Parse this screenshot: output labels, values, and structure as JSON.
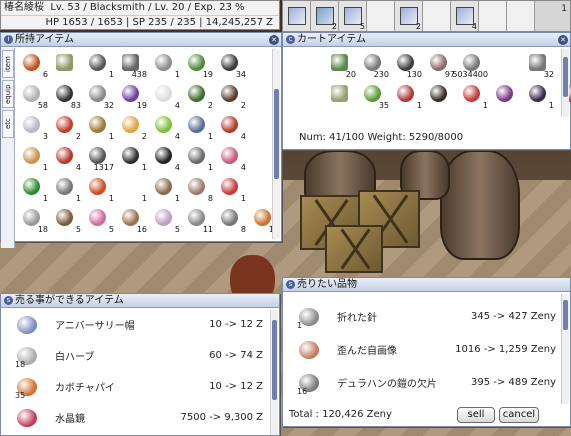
{
  "status": {
    "name": "椿名綾桜",
    "level_line": "Lv. 53 / Blacksmith / Lv. 20 / Exp. 23 %",
    "vitals_line": "HP  1653 / 1653  |  SP  235 / 235  |  14,245,257 Z"
  },
  "hotbar": {
    "slots": [
      "",
      "2",
      "5",
      "",
      "2",
      "",
      "4",
      "",
      ""
    ],
    "page": "1"
  },
  "inventory": {
    "title": "所持アイテム",
    "tabs": [
      "item",
      "equip",
      "etc"
    ],
    "items": [
      {
        "count": "6",
        "color": "#c0541e"
      },
      {
        "count": "",
        "color": "#8f9a6a",
        "box": true
      },
      {
        "count": "1",
        "color": "#555"
      },
      {
        "count": "438",
        "color": "#666",
        "box": true
      },
      {
        "count": "1",
        "color": "#8c8c8c"
      },
      {
        "count": "19",
        "color": "#4f8a3a"
      },
      {
        "count": "34",
        "color": "#3a3a3a"
      },
      {
        "count": "",
        "color": "#fff"
      },
      {
        "count": "58",
        "color": "#b2b2b2"
      },
      {
        "count": "83",
        "color": "#333"
      },
      {
        "count": "32",
        "color": "#888"
      },
      {
        "count": "19",
        "color": "#6b3fa0"
      },
      {
        "count": "4",
        "color": "#ddd"
      },
      {
        "count": "2",
        "color": "#3e6b2e"
      },
      {
        "count": "2",
        "color": "#5b3b2a"
      },
      {
        "count": "",
        "color": "#fff"
      },
      {
        "count": "3",
        "color": "#b8b8c8"
      },
      {
        "count": "2",
        "color": "#c23d2a"
      },
      {
        "count": "1",
        "color": "#9b7a33"
      },
      {
        "count": "2",
        "color": "#e0a442"
      },
      {
        "count": "4",
        "color": "#7cc23a"
      },
      {
        "count": "1",
        "color": "#5a6d99"
      },
      {
        "count": "4",
        "color": "#b33b2a"
      },
      {
        "count": "",
        "color": "#fff"
      },
      {
        "count": "1",
        "color": "#c9954a"
      },
      {
        "count": "4",
        "color": "#b33b2a"
      },
      {
        "count": "1317",
        "color": "#555"
      },
      {
        "count": "1",
        "color": "#2e2e2e"
      },
      {
        "count": "4",
        "color": "#222"
      },
      {
        "count": "1",
        "color": "#6a6a6a"
      },
      {
        "count": "4",
        "color": "#c95a80"
      },
      {
        "count": "",
        "color": "#fff"
      },
      {
        "count": "1",
        "color": "#2e8a2e"
      },
      {
        "count": "1",
        "color": "#777"
      },
      {
        "count": "1",
        "color": "#d04a22"
      },
      {
        "count": "1",
        "color": "#fff"
      },
      {
        "count": "1",
        "color": "#8a6a4a"
      },
      {
        "count": "8",
        "color": "#9b7a6a"
      },
      {
        "count": "1",
        "color": "#c83a3a"
      },
      {
        "count": "",
        "color": "#fff"
      },
      {
        "count": "18",
        "color": "#999"
      },
      {
        "count": "5",
        "color": "#7a5a3a"
      },
      {
        "count": "5",
        "color": "#d06a9a"
      },
      {
        "count": "16",
        "color": "#a07050"
      },
      {
        "count": "5",
        "color": "#c0a0c0"
      },
      {
        "count": "11",
        "color": "#888"
      },
      {
        "count": "8",
        "color": "#777"
      },
      {
        "count": "10",
        "color": "#d0702a"
      }
    ]
  },
  "cart": {
    "title": "カートアイテム",
    "items": [
      {
        "count": "20",
        "color": "#5b8a4a",
        "box": true
      },
      {
        "count": "230",
        "color": "#777"
      },
      {
        "count": "130",
        "color": "#3d3d3d"
      },
      {
        "count": "97",
        "color": "#8a6a6a"
      },
      {
        "count": "5034400",
        "color": "#777"
      },
      {
        "count": "",
        "color": "#fff"
      },
      {
        "count": "32",
        "color": "#777",
        "box": true
      },
      {
        "count": "",
        "color": "#fff"
      },
      {
        "count": "",
        "color": "#9aa070",
        "box": true
      },
      {
        "count": "35",
        "color": "#5c9a3a"
      },
      {
        "count": "1",
        "color": "#b03a3a"
      },
      {
        "count": "",
        "color": "#3a2a2a"
      },
      {
        "count": "1",
        "color": "#c23a3a"
      },
      {
        "count": "",
        "color": "#7a3a8a"
      },
      {
        "count": "1",
        "color": "#3a2a4a"
      },
      {
        "count": "1",
        "color": "#b03a5a"
      }
    ],
    "num_weight": "Num: 41/100  Weight: 5290/8000"
  },
  "sellable": {
    "title": "売る事ができるアイテム",
    "items": [
      {
        "name": "アニバーサリー帽",
        "price": "10 -> 12 Z",
        "count": "",
        "color": "#7a8ac0"
      },
      {
        "name": "白ハーブ",
        "price": "60 -> 74 Z",
        "count": "18",
        "color": "#aaa"
      },
      {
        "name": "カボチャパイ",
        "price": "10 -> 12 Z",
        "count": "35",
        "color": "#d0702a"
      },
      {
        "name": "水晶鏡",
        "price": "7500 -> 9,300 Z",
        "count": "",
        "color": "#c03a5a"
      }
    ]
  },
  "to_sell": {
    "title": "売りたい品物",
    "items": [
      {
        "name": "折れた針",
        "price": "345 -> 427 Zeny",
        "count": "1",
        "color": "#888"
      },
      {
        "name": "歪んだ自画像",
        "price": "1016 -> 1,259 Zeny",
        "count": "",
        "color": "#c07a5a"
      },
      {
        "name": "デュラハンの鎧の欠片",
        "price": "395 -> 489 Zeny",
        "count": "16",
        "color": "#777"
      }
    ],
    "total": "Total : 120,426 Zeny",
    "sell_label": "sell",
    "cancel_label": "cancel"
  }
}
